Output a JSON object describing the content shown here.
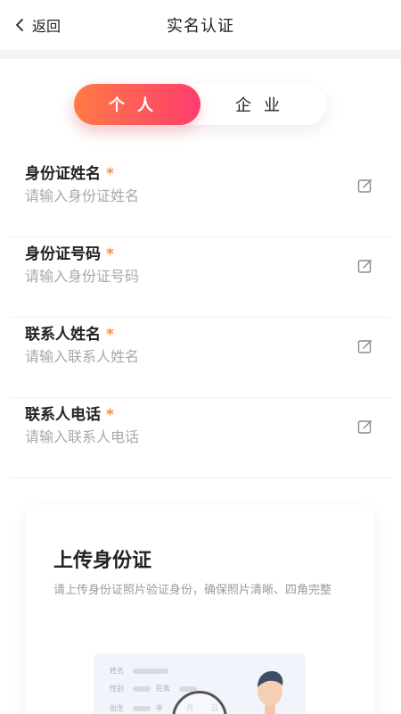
{
  "header": {
    "back_label": "返回",
    "title": "实名认证"
  },
  "tabs": [
    {
      "label": "个人",
      "active": true
    },
    {
      "label": "企业",
      "active": false
    }
  ],
  "form": [
    {
      "label": "身份证姓名",
      "required_mark": "*",
      "placeholder": "请输入身份证姓名"
    },
    {
      "label": "身份证号码",
      "required_mark": "*",
      "placeholder": "请输入身份证号码"
    },
    {
      "label": "联系人姓名",
      "required_mark": "*",
      "placeholder": "请输入联系人姓名"
    },
    {
      "label": "联系人电话",
      "required_mark": "*",
      "placeholder": "请输入联系人电话"
    }
  ],
  "upload": {
    "title": "上传身份证",
    "description": "请上传身份证照片验证身份，确保照片清晰、四角完整",
    "id_card_labels": {
      "name": "姓名",
      "gender": "性别",
      "ethnicity": "民族",
      "birth": "出生",
      "year": "年",
      "month": "月",
      "day": "日"
    }
  },
  "colors": {
    "accent_start": "#ff7a45",
    "accent_end": "#ff3d6e",
    "required": "#ff8a3d"
  },
  "icons": {
    "back": "chevron-left-icon",
    "edit": "edit-icon",
    "camera": "camera-icon",
    "avatar": "avatar-icon"
  }
}
